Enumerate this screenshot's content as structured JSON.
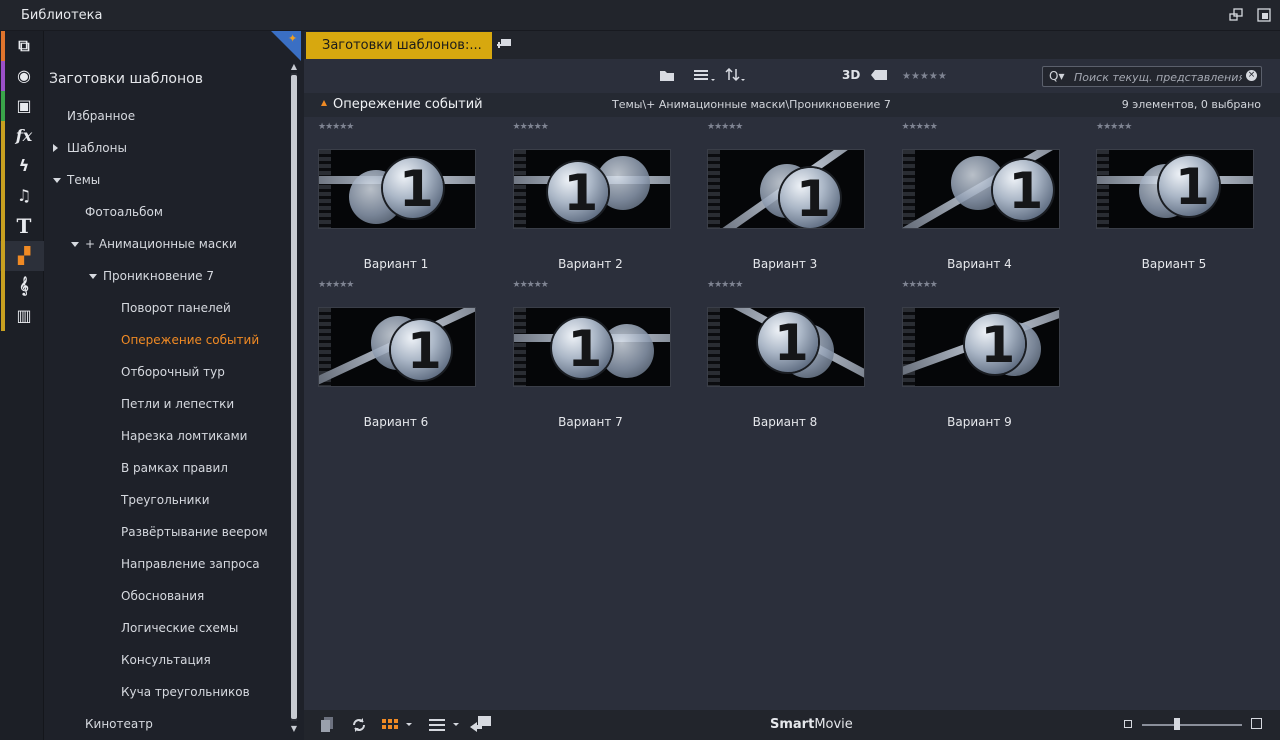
{
  "window": {
    "title": "Библиотека"
  },
  "sidebar_icons": [
    {
      "icon": "box-icon",
      "color": "#e0742c",
      "glyph": "⧉"
    },
    {
      "icon": "film-reel-icon",
      "color": "#9b50c8",
      "glyph": "◉"
    },
    {
      "icon": "layers-icon",
      "color": "#3aa54a",
      "glyph": "▣"
    },
    {
      "icon": "fx-icon",
      "color": "#c8a020",
      "glyph": "fx"
    },
    {
      "icon": "lightning-icon",
      "color": "#c8a020",
      "glyph": "ϟ"
    },
    {
      "icon": "music-note-icon",
      "color": "#c8a020",
      "glyph": "♫"
    },
    {
      "icon": "text-icon",
      "color": "#c8a020",
      "glyph": "T"
    },
    {
      "icon": "template-icon",
      "color": "#c8a020",
      "glyph": "▞"
    },
    {
      "icon": "clef-icon",
      "color": "#c8a020",
      "glyph": "𝄞"
    },
    {
      "icon": "piano-icon",
      "color": "#c8a020",
      "glyph": "▥"
    }
  ],
  "tree": {
    "heading": "Заготовки шаблонов",
    "items": [
      {
        "label": "Избранное",
        "level": 0,
        "expander": ""
      },
      {
        "label": "Шаблоны",
        "level": 0,
        "expander": "right"
      },
      {
        "label": "Темы",
        "level": 0,
        "expander": "down"
      },
      {
        "label": "Фотоальбом",
        "level": 1,
        "expander": ""
      },
      {
        "label": "+ Анимационные маски",
        "level": 1,
        "expander": "down"
      },
      {
        "label": "Проникновение 7",
        "level": 2,
        "expander": "down"
      },
      {
        "label": "Поворот панелей",
        "level": 3,
        "expander": ""
      },
      {
        "label": "Опережение событий",
        "level": 3,
        "expander": "",
        "active": true
      },
      {
        "label": "Отборочный тур",
        "level": 3,
        "expander": ""
      },
      {
        "label": "Петли и лепестки",
        "level": 3,
        "expander": ""
      },
      {
        "label": "Нарезка ломтиками",
        "level": 3,
        "expander": ""
      },
      {
        "label": "В рамках правил",
        "level": 3,
        "expander": ""
      },
      {
        "label": "Треугольники",
        "level": 3,
        "expander": ""
      },
      {
        "label": "Развёртывание веером",
        "level": 3,
        "expander": ""
      },
      {
        "label": "Направление запроса",
        "level": 3,
        "expander": ""
      },
      {
        "label": "Обоснования",
        "level": 3,
        "expander": ""
      },
      {
        "label": "Логические схемы",
        "level": 3,
        "expander": ""
      },
      {
        "label": "Консультация",
        "level": 3,
        "expander": ""
      },
      {
        "label": "Куча треугольников",
        "level": 3,
        "expander": ""
      },
      {
        "label": "Кинотеатр",
        "level": 1,
        "expander": ""
      }
    ]
  },
  "tabs": [
    {
      "label": "Заготовки шаблонов:..."
    }
  ],
  "toolbar": {
    "view_3d": "3D",
    "rating": "★★★★★",
    "search_placeholder": "Поиск текущ. представления",
    "search_value": ""
  },
  "infobar": {
    "title": "Опережение событий",
    "path": "Темы\\+ Анимационные маски\\Проникновение 7",
    "count": "9 элементов, 0 выбрано"
  },
  "items": [
    {
      "label": "Вариант 1",
      "rating": "★★★★★",
      "number": "1"
    },
    {
      "label": "Вариант 2",
      "rating": "★★★★★",
      "number": "1"
    },
    {
      "label": "Вариант 3",
      "rating": "★★★★★",
      "number": "1"
    },
    {
      "label": "Вариант 4",
      "rating": "★★★★★",
      "number": "1"
    },
    {
      "label": "Вариант 5",
      "rating": "★★★★★",
      "number": "1"
    },
    {
      "label": "Вариант 6",
      "rating": "★★★★★",
      "number": "1"
    },
    {
      "label": "Вариант 7",
      "rating": "★★★★★",
      "number": "1"
    },
    {
      "label": "Вариант 8",
      "rating": "★★★★★",
      "number": "1"
    },
    {
      "label": "Вариант 9",
      "rating": "★★★★★",
      "number": "1"
    }
  ],
  "bottombar": {
    "brand_bold": "Smart",
    "brand_rest": "Movie",
    "zoom_level": 0.35
  },
  "colors": {
    "accent": "#f08a24",
    "tab": "#d7a80f",
    "panel": "#2b2f3b"
  }
}
